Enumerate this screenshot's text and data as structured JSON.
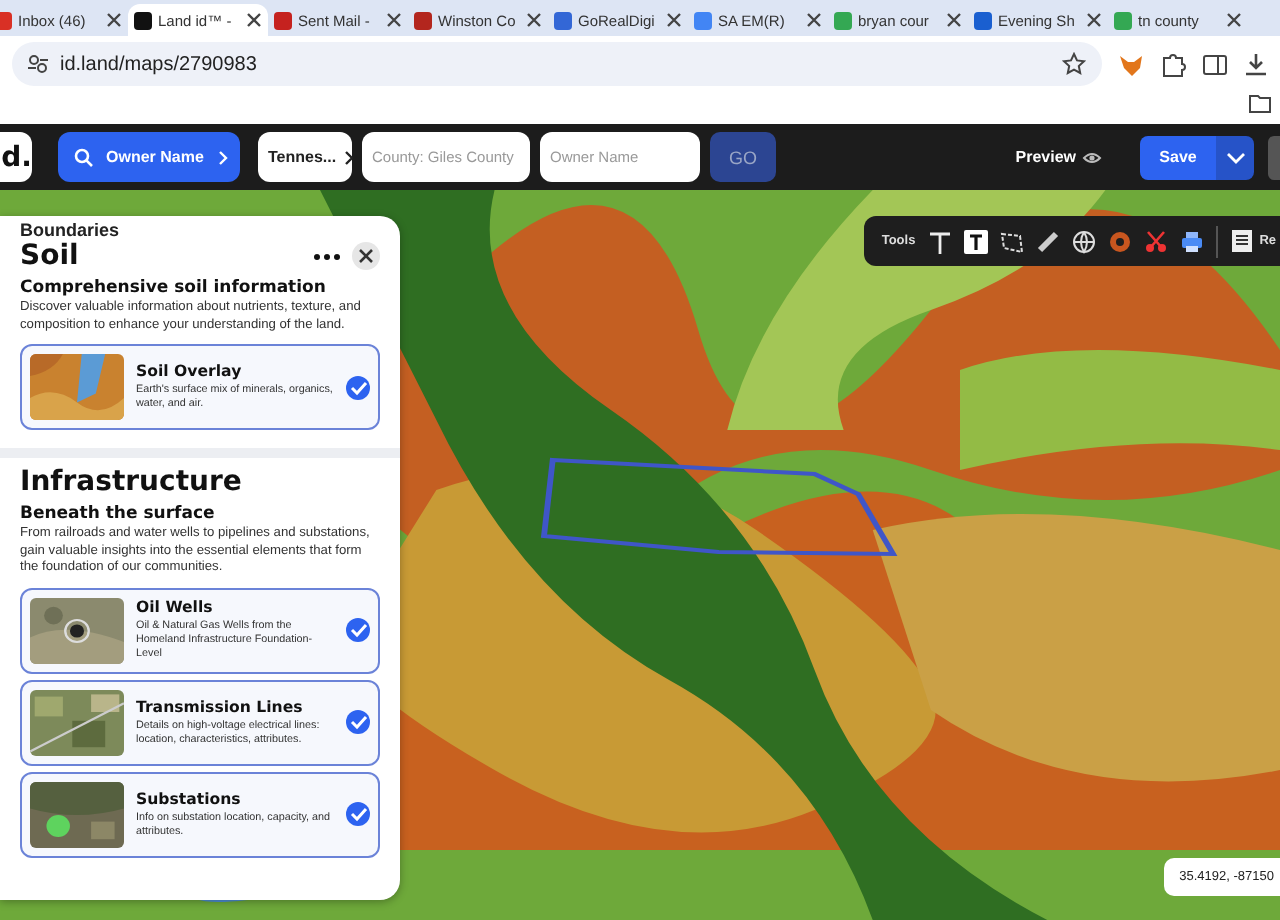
{
  "browser": {
    "tabs": [
      {
        "label": "Inbox (46)",
        "selected": false
      },
      {
        "label": "Land id™ -",
        "selected": true
      },
      {
        "label": "Sent Mail -",
        "selected": false
      },
      {
        "label": "Winston Co",
        "selected": false
      },
      {
        "label": "GoRealDigi",
        "selected": false
      },
      {
        "label": "SA EM(R)",
        "selected": false
      },
      {
        "label": "bryan cour",
        "selected": false
      },
      {
        "label": "Evening Sh",
        "selected": false
      },
      {
        "label": "tn county",
        "selected": false
      }
    ],
    "url": "id.land/maps/2790983"
  },
  "header": {
    "logo": "d.",
    "search_mode": "Owner Name",
    "state": "Tennes...",
    "county_placeholder": "County: Giles County",
    "owner_placeholder": "Owner Name",
    "go": "GO",
    "preview": "Preview",
    "save": "Save"
  },
  "panel": {
    "covered_heading": "Boundaries",
    "sections": [
      {
        "title": "Soil",
        "subtitle": "Comprehensive soil information",
        "description": "Discover valuable information about nutrients, texture, and composition to enhance your understanding of the land.",
        "layers": [
          {
            "name": "Soil Overlay",
            "description": "Earth's surface mix of minerals, organics, water, and air.",
            "checked": true
          }
        ]
      },
      {
        "title": "Infrastructure",
        "subtitle": "Beneath the surface",
        "description": "From railroads and water wells to pipelines and substations, gain valuable insights into the essential elements that form the foundation of our communities.",
        "layers": [
          {
            "name": "Oil Wells",
            "description": "Oil & Natural Gas Wells from the Homeland Infrastructure Foundation-Level",
            "checked": true
          },
          {
            "name": "Transmission Lines",
            "description": "Details on high-voltage electrical lines: location, characteristics, attributes.",
            "checked": true
          },
          {
            "name": "Substations",
            "description": "Info on substation location, capacity, and attributes.",
            "checked": true
          }
        ]
      }
    ]
  },
  "toolbar": {
    "label": "Tools",
    "cut_label": "Re"
  },
  "coordinates": "35.4192, -87150"
}
